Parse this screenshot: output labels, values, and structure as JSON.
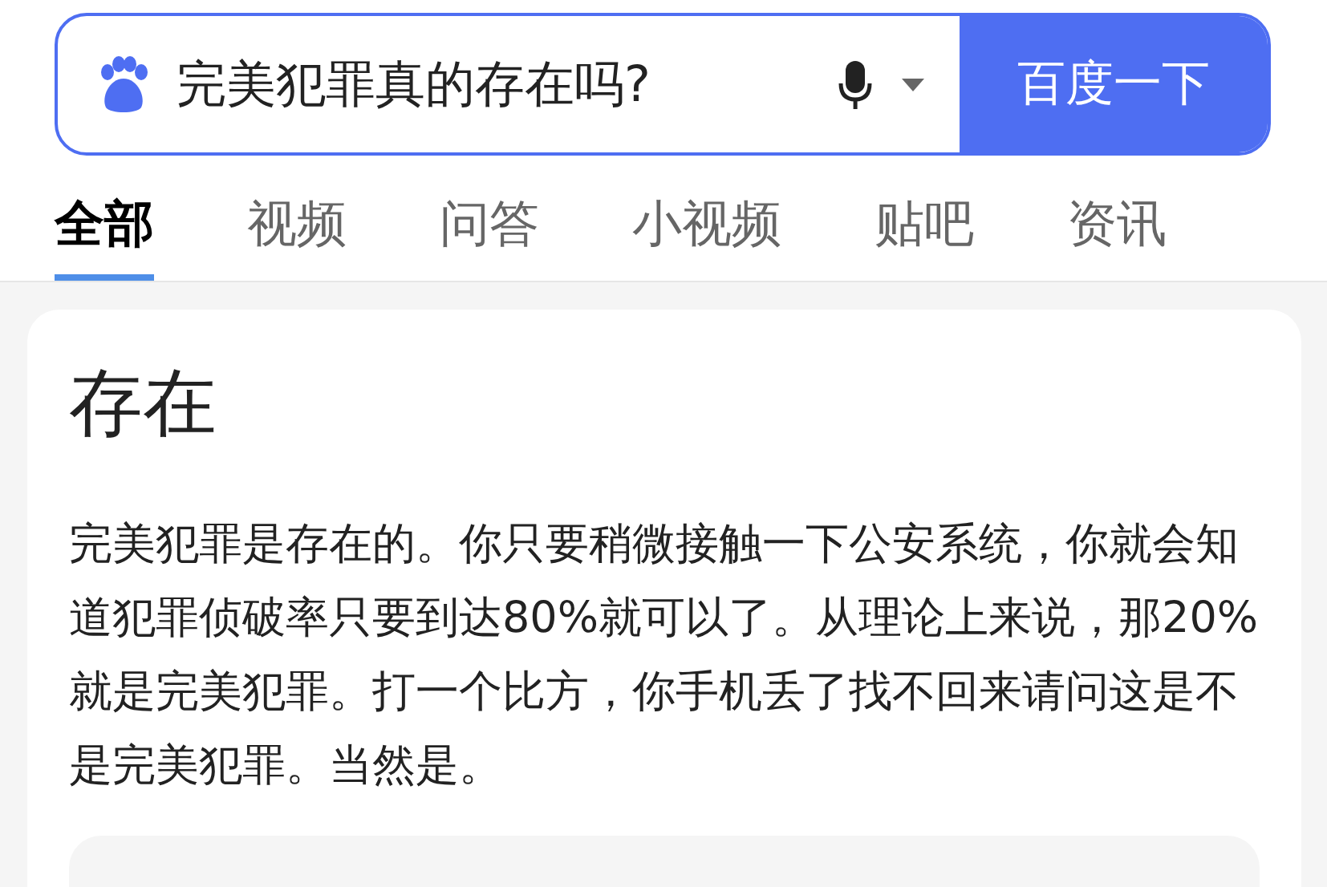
{
  "search": {
    "value": "完美犯罪真的存在吗?",
    "button": "百度一下"
  },
  "tabs": [
    {
      "label": "全部",
      "selected": true
    },
    {
      "label": "视频",
      "selected": false
    },
    {
      "label": "问答",
      "selected": false
    },
    {
      "label": "小视频",
      "selected": false
    },
    {
      "label": "贴吧",
      "selected": false
    },
    {
      "label": "资讯",
      "selected": false
    }
  ],
  "answer": {
    "title": "存在",
    "text": "完美犯罪是存在的。你只要稍微接触一下公安系统，你就会知道犯罪侦破率只要到达80%就可以了。从理论上来说，那20%就是完美犯罪。打一个比方，你手机丢了找不回来请问这是不是完美犯罪。当然是。"
  }
}
